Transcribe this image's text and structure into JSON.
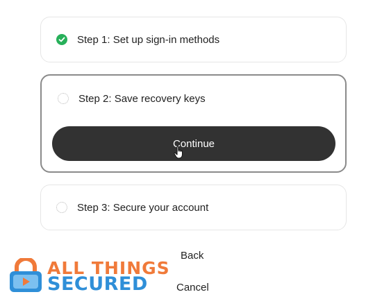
{
  "steps": [
    {
      "label": "Step 1: Set up sign-in methods",
      "status": "complete"
    },
    {
      "label": "Step 2: Save recovery keys",
      "status": "active"
    },
    {
      "label": "Step 3: Secure your account",
      "status": "pending"
    }
  ],
  "continue_label": "Continue",
  "back_label": "Back",
  "cancel_label": "Cancel",
  "logo": {
    "line1": "ALL THINGS",
    "line2": "SECURED"
  },
  "colors": {
    "check_green": "#27b05a",
    "button_dark": "#323232",
    "logo_orange": "#f07a3a",
    "logo_blue": "#2f8fd8"
  }
}
